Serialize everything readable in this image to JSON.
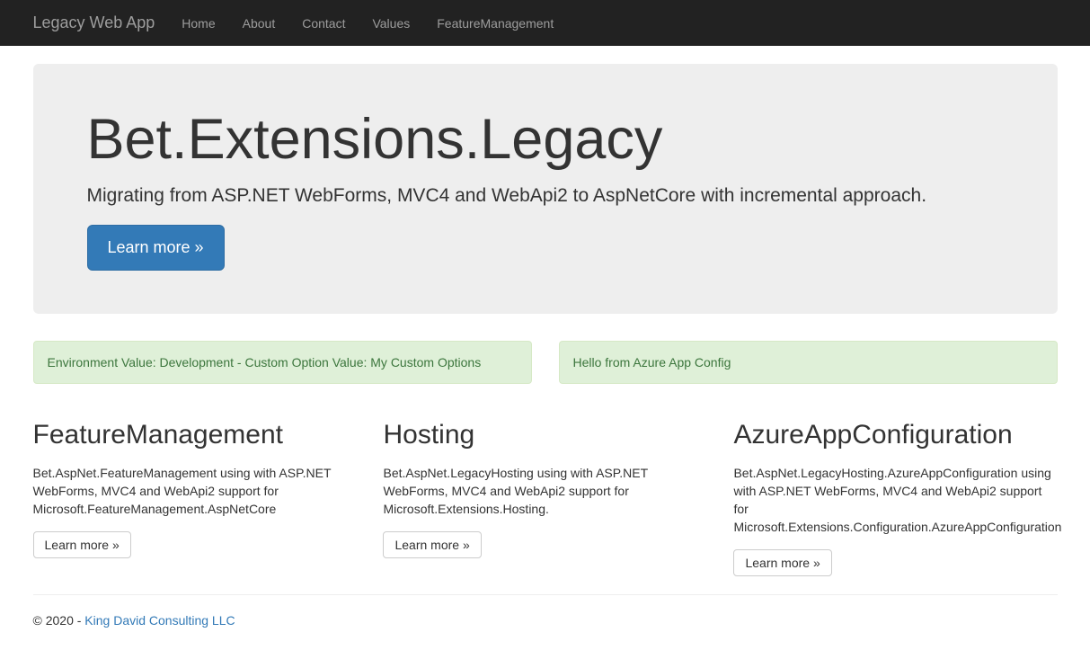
{
  "nav": {
    "brand": "Legacy Web App",
    "items": [
      {
        "label": "Home"
      },
      {
        "label": "About"
      },
      {
        "label": "Contact"
      },
      {
        "label": "Values"
      },
      {
        "label": "FeatureManagement"
      }
    ]
  },
  "jumbotron": {
    "title": "Bet.Extensions.Legacy",
    "lead": "Migrating from ASP.NET WebForms, MVC4 and WebApi2 to AspNetCore with incremental approach.",
    "button": "Learn more »"
  },
  "alerts": {
    "left": "Environment Value: Development - Custom Option Value: My Custom Options",
    "right": "Hello from Azure App Config"
  },
  "features": [
    {
      "title": "FeatureManagement",
      "desc": "Bet.AspNet.FeatureManagement using with ASP.NET WebForms, MVC4 and WebApi2 support for Microsoft.FeatureManagement.AspNetCore",
      "button": "Learn more »"
    },
    {
      "title": "Hosting",
      "desc": "Bet.AspNet.LegacyHosting using with ASP.NET WebForms, MVC4 and WebApi2 support for Microsoft.Extensions.Hosting.",
      "button": "Learn more »"
    },
    {
      "title": "AzureAppConfiguration",
      "desc": "Bet.AspNet.LegacyHosting.AzureAppConfiguration using with ASP.NET WebForms, MVC4 and WebApi2 support for Microsoft.Extensions.Configuration.AzureAppConfiguration",
      "button": "Learn more »"
    }
  ],
  "footer": {
    "prefix": "© 2020 - ",
    "link": "King David Consulting LLC"
  }
}
